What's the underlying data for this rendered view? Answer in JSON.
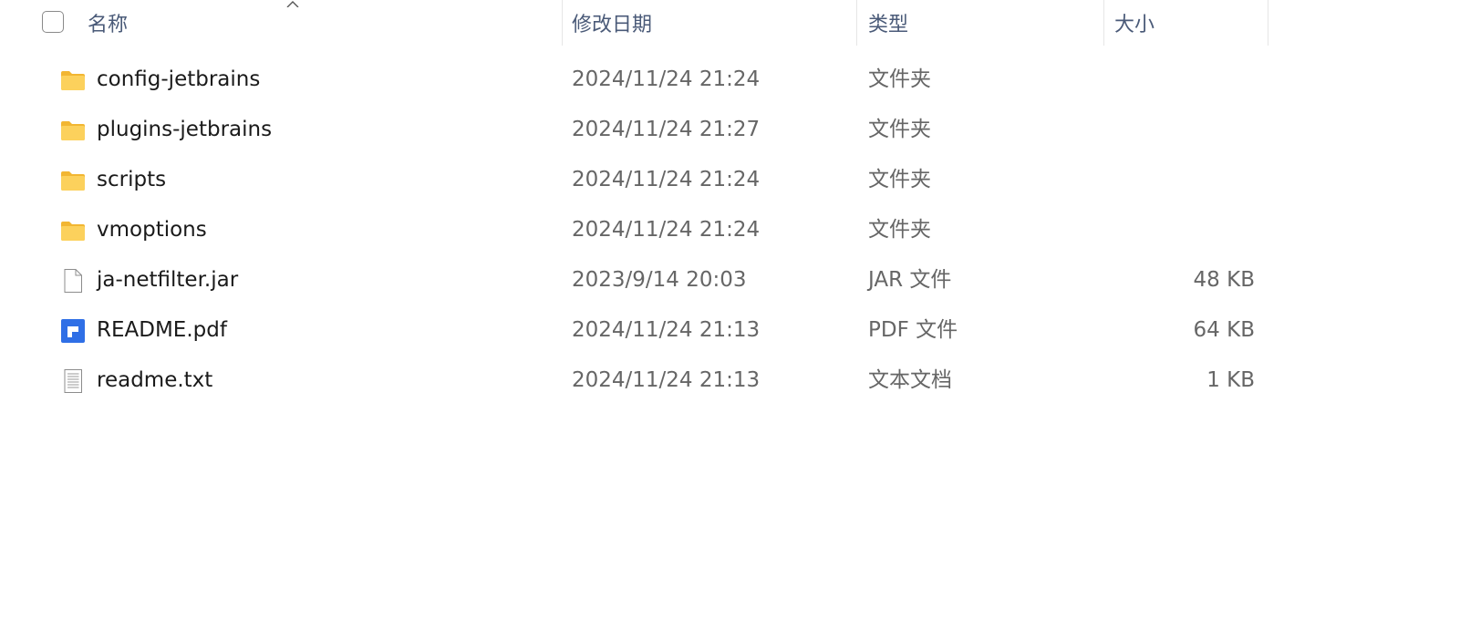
{
  "columns": {
    "name": "名称",
    "modified": "修改日期",
    "type": "类型",
    "size": "大小"
  },
  "files": [
    {
      "name": "config-jetbrains",
      "modified": "2024/11/24 21:24",
      "type": "文件夹",
      "size": "",
      "icon": "folder-icon"
    },
    {
      "name": "plugins-jetbrains",
      "modified": "2024/11/24 21:27",
      "type": "文件夹",
      "size": "",
      "icon": "folder-icon"
    },
    {
      "name": "scripts",
      "modified": "2024/11/24 21:24",
      "type": "文件夹",
      "size": "",
      "icon": "folder-icon"
    },
    {
      "name": "vmoptions",
      "modified": "2024/11/24 21:24",
      "type": "文件夹",
      "size": "",
      "icon": "folder-icon"
    },
    {
      "name": "ja-netfilter.jar",
      "modified": "2023/9/14 20:03",
      "type": "JAR 文件",
      "size": "48 KB",
      "icon": "file-icon"
    },
    {
      "name": "README.pdf",
      "modified": "2024/11/24 21:13",
      "type": "PDF 文件",
      "size": "64 KB",
      "icon": "pdf-icon"
    },
    {
      "name": "readme.txt",
      "modified": "2024/11/24 21:13",
      "type": "文本文档",
      "size": "1 KB",
      "icon": "text-file-icon"
    }
  ],
  "colors": {
    "header_text": "#4a5a78",
    "name_text": "#1a1a1a",
    "detail_text": "#666666",
    "folder": "#f6c84a",
    "pdf": "#2f6fe6"
  }
}
